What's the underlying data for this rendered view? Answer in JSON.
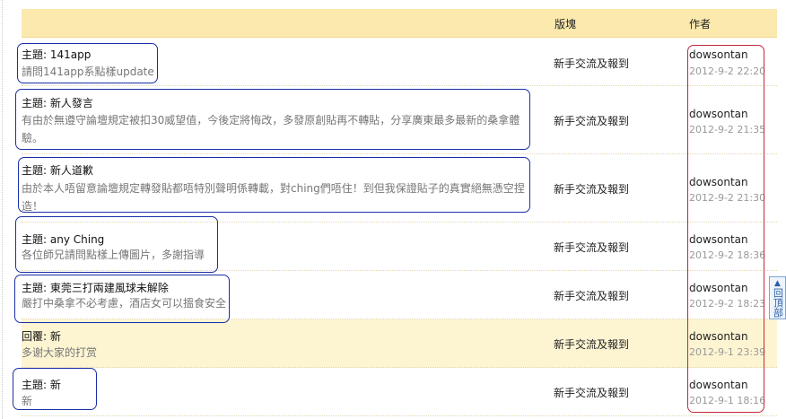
{
  "header": {
    "forum_label": "版塊",
    "author_label": "作者"
  },
  "rows": [
    {
      "title_prefix": "主題:",
      "title": "141app",
      "snippet": "請問141app系點樣update",
      "forum": "新手交流及報到",
      "author": "dowsontan",
      "date": "2012-9-2 22:20"
    },
    {
      "title_prefix": "主題:",
      "title": "新人發言",
      "snippet": "有由於無遵守論壇規定被扣30威望值，今後定將悔改，多發原創貼再不轉貼，分享廣東最多最新的桑拿體驗。",
      "forum": "新手交流及報到",
      "author": "dowsontan",
      "date": "2012-9-2 21:35"
    },
    {
      "title_prefix": "主題:",
      "title": "新人道歉",
      "snippet": "由於本人唔留意論壇規定轉發貼都唔特別聲明係轉載，對ching們唔住！到但我保證貼子的真實絕無憑空捏造！",
      "forum": "新手交流及報到",
      "author": "dowsontan",
      "date": "2012-9-2 21:30"
    },
    {
      "title_prefix": "主題:",
      "title": "any Ching",
      "snippet": "各位師兄請問點樣上傳圖片，多謝指導",
      "forum": "新手交流及報到",
      "author": "dowsontan",
      "date": "2012-9-2 18:36"
    },
    {
      "title_prefix": "主題:",
      "title": "東莞三打兩建風球未解除",
      "snippet": "嚴打中桑拿不必考慮，酒店女可以搵食安全",
      "forum": "新手交流及報到",
      "author": "dowsontan",
      "date": "2012-9-2 18:23"
    },
    {
      "title_prefix": "回覆:",
      "title": "新",
      "snippet": "多谢大家的打赏",
      "forum": "新手交流及報到",
      "author": "dowsontan",
      "date": "2012-9-1 23:39"
    },
    {
      "title_prefix": "主題:",
      "title": "新",
      "snippet": "新",
      "forum": "新手交流及報到",
      "author": "dowsontan",
      "date": "2012-9-1 18:16"
    }
  ],
  "back_to_top": {
    "label": "回頂部",
    "icon": "arrow-up-icon"
  },
  "colors": {
    "header_bg": "#fbe9ae",
    "highlight_row": "#fdf4d2",
    "annotation_blue": "#1a2fa8",
    "annotation_red": "#c2283a"
  }
}
